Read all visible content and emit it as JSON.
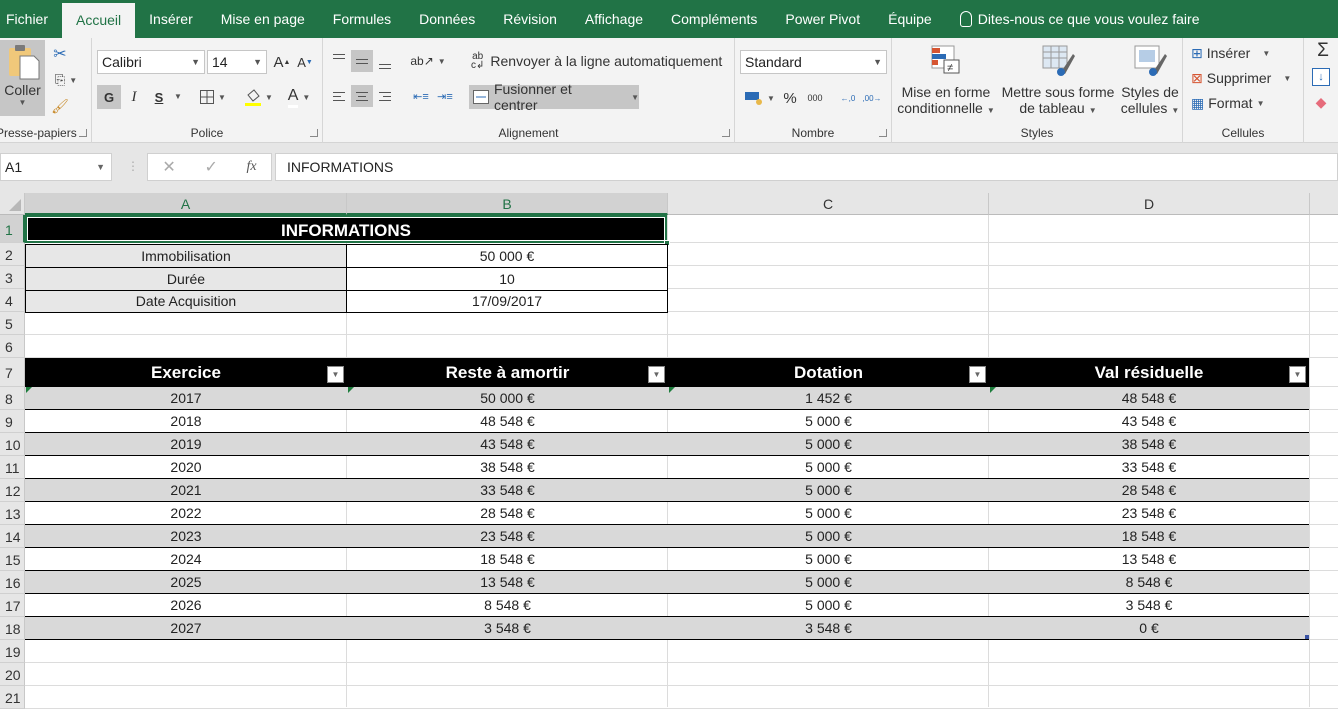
{
  "ribbon_tabs": [
    {
      "label": "Fichier",
      "active": false
    },
    {
      "label": "Accueil",
      "active": true
    },
    {
      "label": "Insérer",
      "active": false
    },
    {
      "label": "Mise en page",
      "active": false
    },
    {
      "label": "Formules",
      "active": false
    },
    {
      "label": "Données",
      "active": false
    },
    {
      "label": "Révision",
      "active": false
    },
    {
      "label": "Affichage",
      "active": false
    },
    {
      "label": "Compléments",
      "active": false
    },
    {
      "label": "Power Pivot",
      "active": false
    },
    {
      "label": "Équipe",
      "active": false
    }
  ],
  "tell_me": "Dites-nous ce que vous voulez faire",
  "groups": {
    "clipboard": {
      "label": "Presse-papiers",
      "paste": "Coller"
    },
    "font": {
      "label": "Police",
      "font_name": "Calibri",
      "font_size": "14",
      "bold": "G",
      "italic": "I",
      "underline": "S"
    },
    "alignment": {
      "label": "Alignement",
      "wrap": "Renvoyer à la ligne automatiquement",
      "merge": "Fusionner et centrer"
    },
    "number": {
      "label": "Nombre",
      "format": "Standard",
      "percent": "%",
      "thousands": "000",
      "inc_decimal": "←,0 ,00",
      "dec_decimal": ",00 →,0"
    },
    "styles": {
      "label": "Styles",
      "conditional": [
        "Mise en forme",
        "conditionnelle"
      ],
      "as_table": [
        "Mettre sous forme",
        "de tableau"
      ],
      "cell_styles": [
        "Styles de",
        "cellules"
      ]
    },
    "cells": {
      "label": "Cellules",
      "insert": "Insérer",
      "delete": "Supprimer",
      "format": "Format"
    },
    "editing": {
      "sum": "Σ"
    }
  },
  "formula_bar": {
    "name_box": "A1",
    "fx": "fx",
    "content": "INFORMATIONS"
  },
  "columns": [
    "A",
    "B",
    "C",
    "D"
  ],
  "rows": [
    "1",
    "2",
    "3",
    "4",
    "5",
    "6",
    "7",
    "8",
    "9",
    "10",
    "11",
    "12",
    "13",
    "14",
    "15",
    "16",
    "17",
    "18",
    "19",
    "20",
    "21"
  ],
  "info": {
    "title": "INFORMATIONS",
    "items": [
      {
        "label": "Immobilisation",
        "value": "50 000 €"
      },
      {
        "label": "Durée",
        "value": "10"
      },
      {
        "label": "Date Acquisition",
        "value": "17/09/2017"
      }
    ]
  },
  "table": {
    "headers": [
      "Exercice",
      "Reste à amortir",
      "Dotation",
      "Val résiduelle"
    ],
    "rows": [
      [
        "2017",
        "50 000 €",
        "1 452 €",
        "48 548 €"
      ],
      [
        "2018",
        "48 548 €",
        "5 000 €",
        "43 548 €"
      ],
      [
        "2019",
        "43 548 €",
        "5 000 €",
        "38 548 €"
      ],
      [
        "2020",
        "38 548 €",
        "5 000 €",
        "33 548 €"
      ],
      [
        "2021",
        "33 548 €",
        "5 000 €",
        "28 548 €"
      ],
      [
        "2022",
        "28 548 €",
        "5 000 €",
        "23 548 €"
      ],
      [
        "2023",
        "23 548 €",
        "5 000 €",
        "18 548 €"
      ],
      [
        "2024",
        "18 548 €",
        "5 000 €",
        "13 548 €"
      ],
      [
        "2025",
        "13 548 €",
        "5 000 €",
        "8 548 €"
      ],
      [
        "2026",
        "8 548 €",
        "5 000 €",
        "3 548 €"
      ],
      [
        "2027",
        "3 548 €",
        "3 548 €",
        "0 €"
      ]
    ]
  },
  "colors": {
    "accent": "#217346",
    "table_header_bg": "#000000",
    "band": "#d9d9d9",
    "label_bg": "#e7e7e7"
  }
}
